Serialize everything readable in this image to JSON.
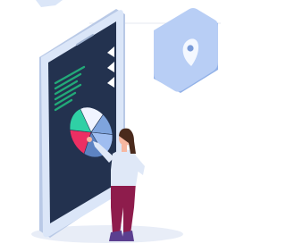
{
  "palette": {
    "background": "#ffffff",
    "screen": "#23324f",
    "phone_frame": "#dbe6f8",
    "phone_side": "#b9c9e6",
    "text_lines": "#22a978",
    "triangles": "#ffffff",
    "pie_slices": [
      "#f0f4ff",
      "#7fa4dd",
      "#9fbdf0",
      "#5d83c2",
      "#ec2f63",
      "#2fd0a5"
    ],
    "pin_tile": "#b8cef5",
    "pin_tile_side": "#93b2e8",
    "pin": "#f4f8ff",
    "pin_dot": "#7a9bd8",
    "hair": "#4a2a1c",
    "skin": "#f6b7a0",
    "shirt": "#dfe8f7",
    "pants": "#8e1c4c",
    "shoes": "#5b3f8f",
    "shadow": "#e8edf7"
  },
  "icons": [
    "map-pin-icon",
    "pie-chart-icon",
    "triangle-bullet-icon"
  ],
  "pie_chart": {
    "slices": [
      18,
      14,
      16,
      16,
      18,
      18
    ]
  }
}
